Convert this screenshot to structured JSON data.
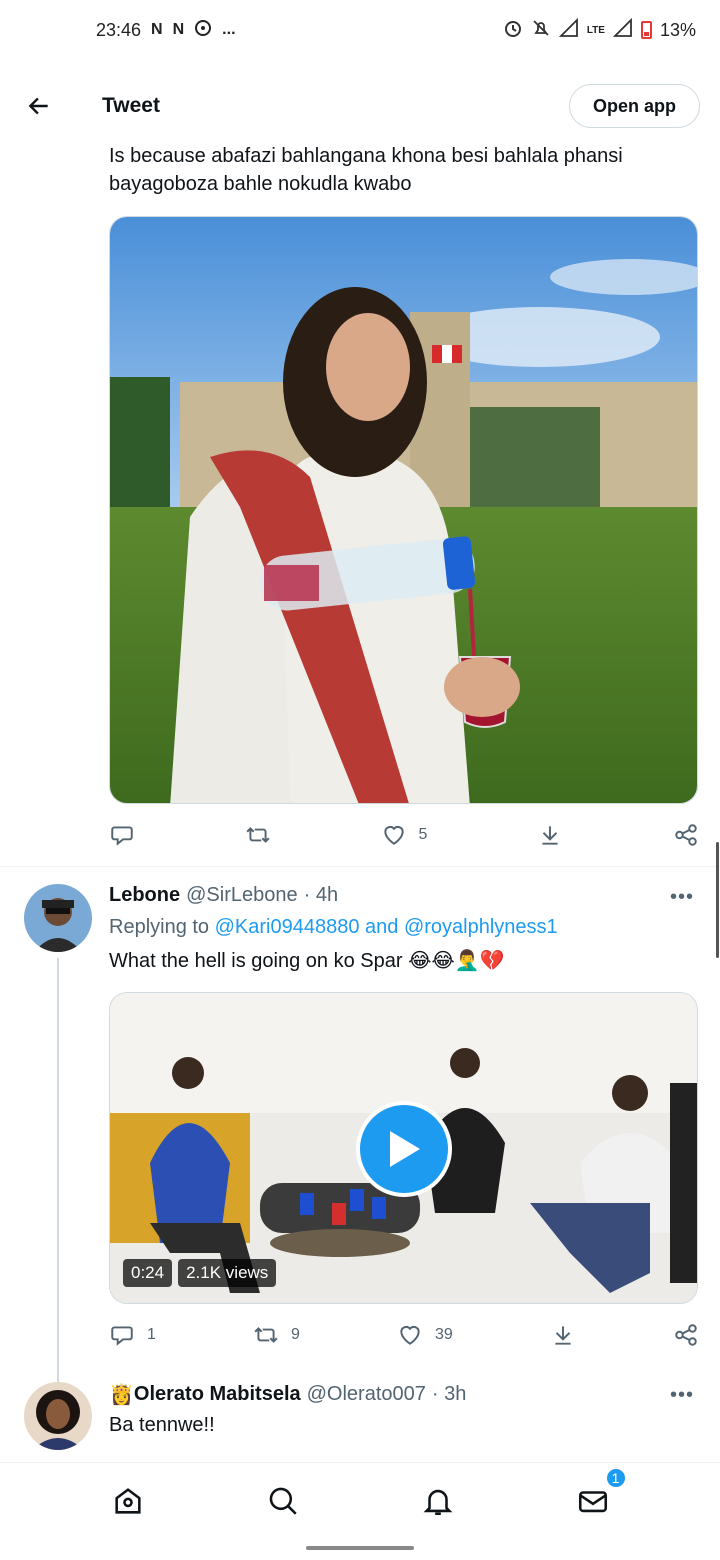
{
  "status_bar": {
    "time": "23:46",
    "left_icons": [
      "N",
      "N",
      "messenger-icon",
      "..."
    ],
    "network": "LTE",
    "battery": "13%"
  },
  "header": {
    "title": "Tweet",
    "open_app_label": "Open app"
  },
  "main_tweet": {
    "text": "Is because abafazi bahlangana khona besi bahlala phansi bayagoboza bahle nokudla kwabo",
    "likes": "5"
  },
  "reply1": {
    "name": "Lebone",
    "handle": "@SirLebone",
    "time": "· 4h",
    "replying_prefix": "Replying to",
    "replying_to": "@Kari09448880 and @royalphlyness1",
    "text": "What the hell is going on ko Spar 😂😂🤦‍♂️💔",
    "video_duration": "0:24",
    "video_views": "2.1K views",
    "replies": "1",
    "retweets": "9",
    "likes": "39"
  },
  "reply2": {
    "emoji": "👸",
    "name": "Olerato Mabitsela",
    "handle": "@Olerato007",
    "time": "· 3h",
    "text": "Ba tennwe!!"
  },
  "bottom_nav": {
    "items": [
      "home-icon",
      "search-icon",
      "notifications-icon",
      "messages-icon"
    ],
    "messages_badge": "1"
  },
  "colors": {
    "accent": "#1d9bf0",
    "secondary_text": "#536471",
    "primary_text": "#0f1419",
    "border": "#cfd9de"
  }
}
